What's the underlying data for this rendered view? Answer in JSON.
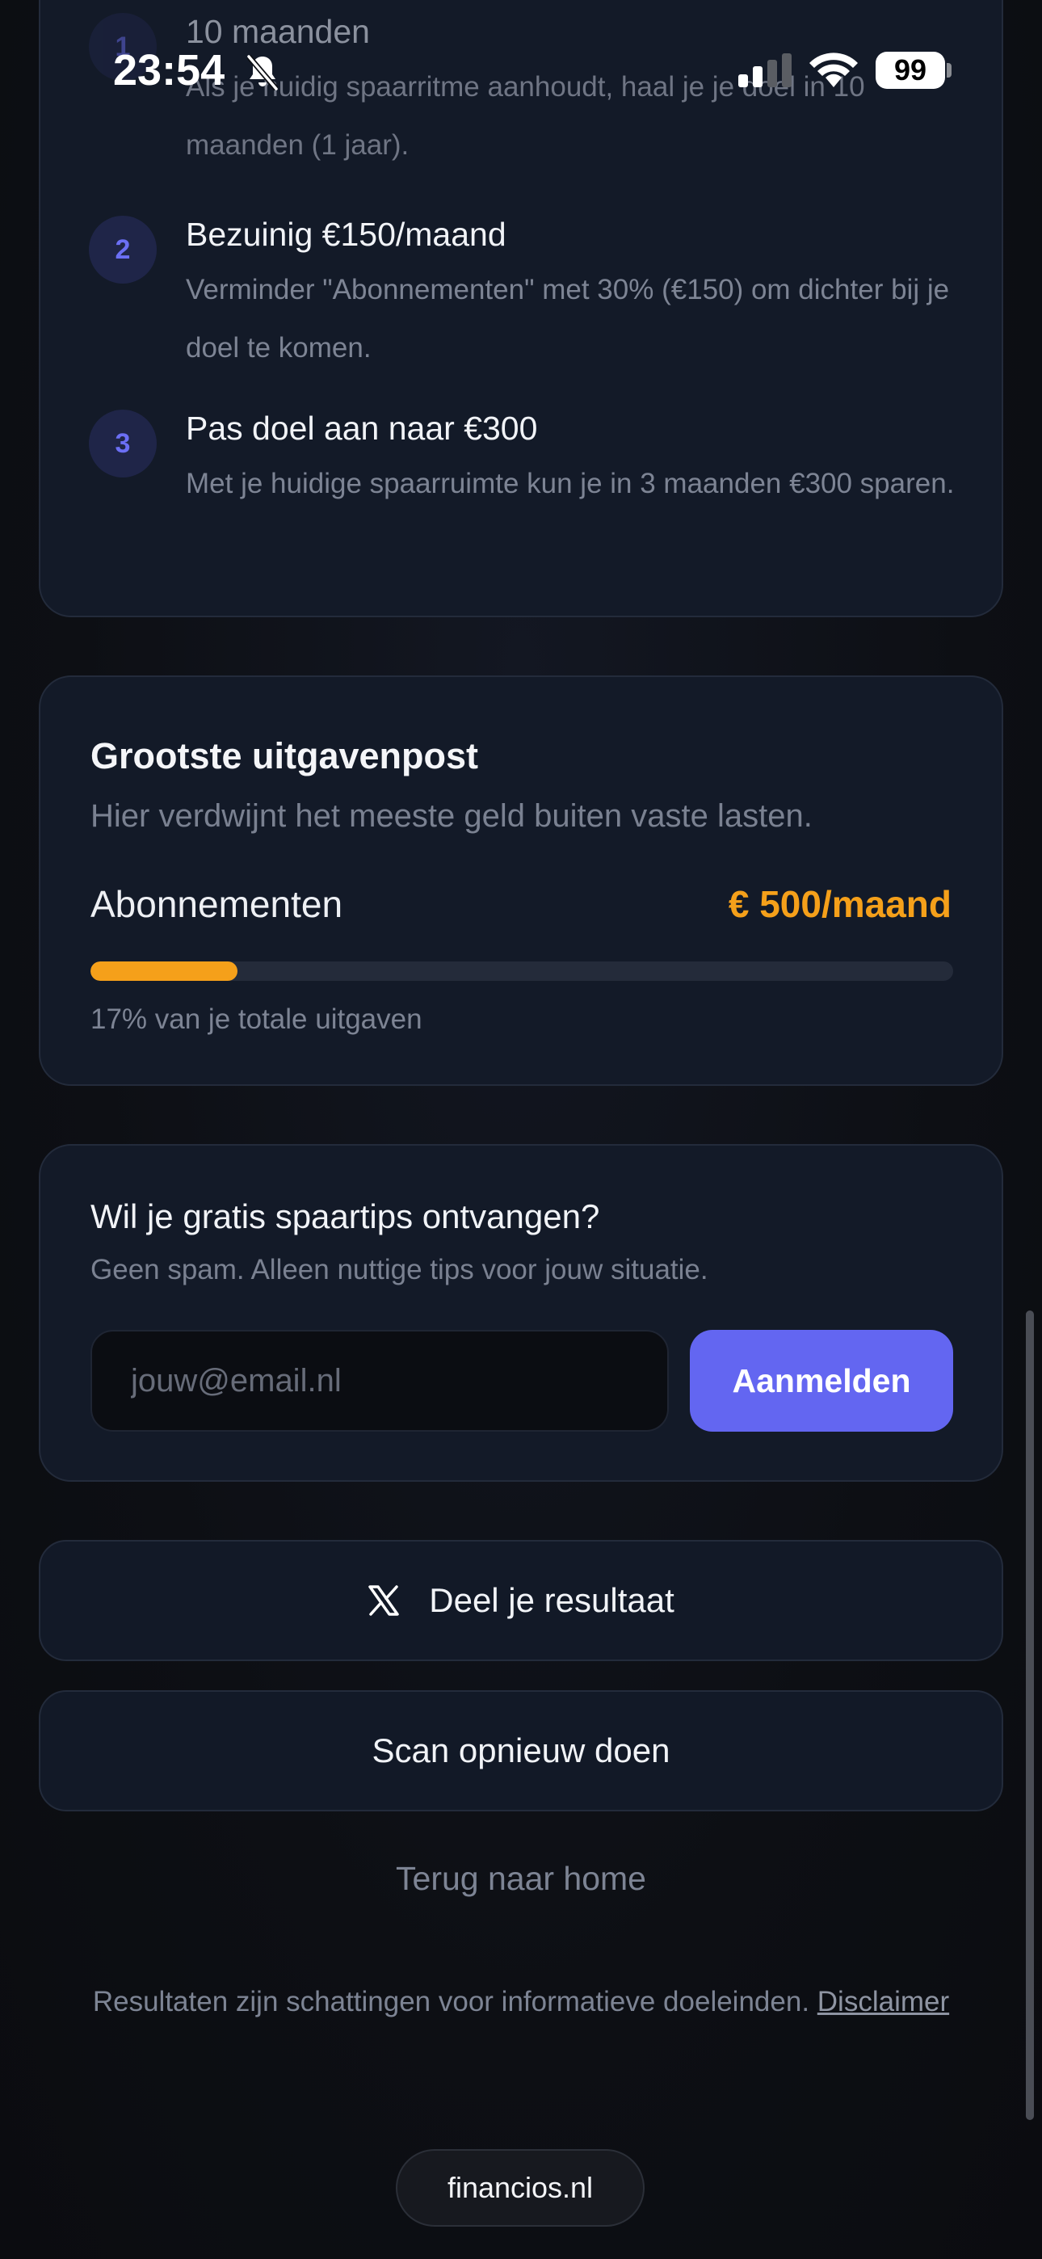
{
  "status_bar": {
    "time": "23:54",
    "battery": "99",
    "icons": [
      "bell-slash-icon",
      "cellular-signal-icon",
      "wifi-icon",
      "battery-icon"
    ]
  },
  "steps": [
    {
      "number": "1",
      "title": "10 maanden",
      "description": "Als je huidig spaarritme aanhoudt, haal je je doel in 10 maanden (1 jaar)."
    },
    {
      "number": "2",
      "title": "Bezuinig €150/maand",
      "description": "Verminder \"Abonnementen\" met 30% (€150) om dichter bij je doel te komen."
    },
    {
      "number": "3",
      "title": "Pas doel aan naar €300",
      "description": "Met je huidige spaarruimte kun je in 3 maanden €300 sparen."
    }
  ],
  "expense": {
    "title": "Grootste uitgavenpost",
    "subtitle": "Hier verdwijnt het meeste geld buiten vaste lasten.",
    "category": "Abonnementen",
    "amount": "€ 500/maand",
    "share_fraction": 0.17,
    "share_note": "17% van je totale uitgaven",
    "accent_color": "#f5a01a"
  },
  "newsletter": {
    "title": "Wil je gratis spaartips ontvangen?",
    "subtitle": "Geen spam. Alleen nuttige tips voor jouw situatie.",
    "email_value": "",
    "email_placeholder": "jouw@email.nl",
    "submit_label": "Aanmelden",
    "accent_color": "#6366f1"
  },
  "actions": {
    "share_label": "Deel je resultaat",
    "share_icon": "x-logo-icon",
    "rescan_label": "Scan opnieuw doen",
    "home_label": "Terug naar home"
  },
  "footer": {
    "disclaimer_text": "Resultaten zijn schattingen voor informatieve doeleinden.",
    "disclaimer_link": "Disclaimer"
  },
  "browser": {
    "domain": "financios.nl"
  }
}
